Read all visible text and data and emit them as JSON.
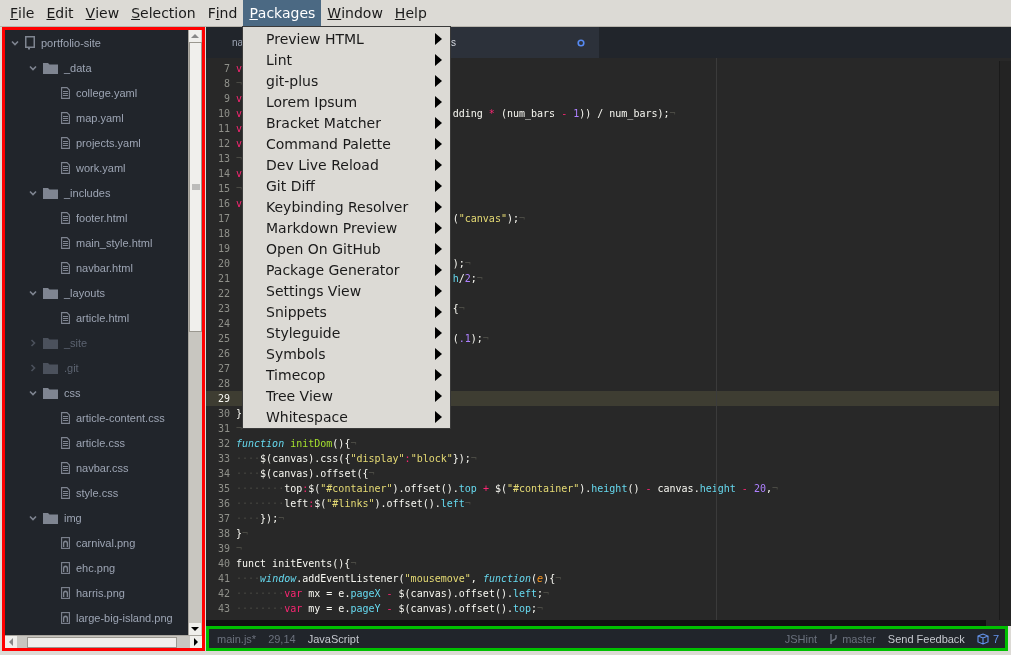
{
  "menubar": [
    {
      "mnemonic": "F",
      "rest": "ile",
      "selected": false
    },
    {
      "mnemonic": "E",
      "rest": "dit",
      "selected": false
    },
    {
      "mnemonic": "V",
      "rest": "iew",
      "selected": false
    },
    {
      "mnemonic": "S",
      "rest": "election",
      "selected": false
    },
    {
      "before": "F",
      "mnemonic": "i",
      "rest": "nd",
      "selected": false
    },
    {
      "mnemonic": "P",
      "rest": "ackages",
      "selected": true
    },
    {
      "mnemonic": "W",
      "rest": "indow",
      "selected": false
    },
    {
      "mnemonic": "H",
      "rest": "elp",
      "selected": false
    }
  ],
  "packages_menu": [
    {
      "label": "Preview HTML"
    },
    {
      "label": "Lint"
    },
    {
      "label": "git-plus"
    },
    {
      "label": "Lorem Ipsum"
    },
    {
      "label": "Bracket Matcher"
    },
    {
      "label": "Command Palette"
    },
    {
      "label": "Dev Live Reload"
    },
    {
      "label": "Git Diff"
    },
    {
      "label": "Keybinding Resolver"
    },
    {
      "label": "Markdown Preview"
    },
    {
      "label": "Open On GitHub"
    },
    {
      "label": "Package Generator"
    },
    {
      "label": "Settings View"
    },
    {
      "label": "Snippets"
    },
    {
      "label": "Styleguide"
    },
    {
      "label": "Symbols"
    },
    {
      "label": "Timecop"
    },
    {
      "label": "Tree View"
    },
    {
      "label": "Whitespace"
    }
  ],
  "tree": [
    {
      "label": "portfolio-site",
      "kind": "repo",
      "expanded": true,
      "dimmed": false,
      "children": [
        {
          "label": "_data",
          "kind": "folder",
          "expanded": true,
          "dimmed": false,
          "children": [
            {
              "label": "college.yaml",
              "kind": "file",
              "dimmed": false
            },
            {
              "label": "map.yaml",
              "kind": "file",
              "dimmed": false
            },
            {
              "label": "projects.yaml",
              "kind": "file",
              "dimmed": false
            },
            {
              "label": "work.yaml",
              "kind": "file",
              "dimmed": false
            }
          ]
        },
        {
          "label": "_includes",
          "kind": "folder",
          "expanded": true,
          "dimmed": false,
          "children": [
            {
              "label": "footer.html",
              "kind": "file",
              "dimmed": false
            },
            {
              "label": "main_style.html",
              "kind": "file",
              "dimmed": false
            },
            {
              "label": "navbar.html",
              "kind": "file",
              "dimmed": false
            }
          ]
        },
        {
          "label": "_layouts",
          "kind": "folder",
          "expanded": true,
          "dimmed": false,
          "children": [
            {
              "label": "article.html",
              "kind": "file",
              "dimmed": false
            }
          ]
        },
        {
          "label": "_site",
          "kind": "folder",
          "expanded": false,
          "dimmed": true
        },
        {
          "label": ".git",
          "kind": "folder",
          "expanded": false,
          "dimmed": true
        },
        {
          "label": "css",
          "kind": "folder",
          "expanded": true,
          "dimmed": false,
          "children": [
            {
              "label": "article-content.css",
              "kind": "file",
              "dimmed": false
            },
            {
              "label": "article.css",
              "kind": "file",
              "dimmed": false
            },
            {
              "label": "navbar.css",
              "kind": "file",
              "dimmed": false
            },
            {
              "label": "style.css",
              "kind": "file",
              "dimmed": false
            }
          ]
        },
        {
          "label": "img",
          "kind": "folder",
          "expanded": true,
          "dimmed": false,
          "children": [
            {
              "label": "carnival.png",
              "kind": "image",
              "dimmed": false
            },
            {
              "label": "ehc.png",
              "kind": "image",
              "dimmed": false
            },
            {
              "label": "harris.png",
              "kind": "image",
              "dimmed": false
            },
            {
              "label": "large-big-island.png",
              "kind": "image",
              "dimmed": false
            }
          ]
        }
      ]
    }
  ],
  "tabs": [
    {
      "label": "na",
      "selected": false
    },
    {
      "label": "s",
      "selected": true,
      "modified": true
    }
  ],
  "code_lines": [
    {
      "number": "7",
      "current": false,
      "left": [
        {
          "text": "v",
          "kind": "keyword"
        }
      ]
    },
    {
      "number": "8",
      "current": false,
      "left": [
        {
          "text": "¬",
          "kind": "invisible"
        }
      ]
    },
    {
      "number": "9",
      "current": false,
      "left": [
        {
          "text": "v",
          "kind": "keyword"
        }
      ]
    },
    {
      "number": "10",
      "current": false,
      "left": [
        {
          "text": "v",
          "kind": "keyword"
        }
      ],
      "right": [
        {
          "text": "dding ",
          "kind": "plain"
        },
        {
          "text": "*",
          "kind": "keyword"
        },
        {
          "text": " (num_bars ",
          "kind": "plain"
        },
        {
          "text": "-",
          "kind": "keyword"
        },
        {
          "text": " 1",
          "kind": "number"
        },
        {
          "text": ")) / num_bars);",
          "kind": "plain"
        },
        {
          "text": "¬",
          "kind": "invisible"
        }
      ]
    },
    {
      "number": "11",
      "current": false,
      "left": [
        {
          "text": "v",
          "kind": "keyword"
        }
      ]
    },
    {
      "number": "12",
      "current": false,
      "left": [
        {
          "text": "v",
          "kind": "keyword"
        }
      ]
    },
    {
      "number": "13",
      "current": false,
      "left": [
        {
          "text": "¬",
          "kind": "invisible"
        }
      ]
    },
    {
      "number": "14",
      "current": false,
      "left": [
        {
          "text": "v",
          "kind": "keyword"
        }
      ]
    },
    {
      "number": "15",
      "current": false,
      "left": [
        {
          "text": "¬",
          "kind": "invisible"
        }
      ]
    },
    {
      "number": "16",
      "current": false,
      "left": [
        {
          "text": "v",
          "kind": "keyword"
        }
      ]
    },
    {
      "number": "17",
      "current": false,
      "right": [
        {
          "text": "(",
          "kind": "plain"
        },
        {
          "text": "\"canvas\"",
          "kind": "string"
        },
        {
          "text": ");",
          "kind": "plain"
        },
        {
          "text": "¬",
          "kind": "invisible"
        }
      ]
    },
    {
      "number": "18",
      "current": false
    },
    {
      "number": "19",
      "current": false
    },
    {
      "number": "20",
      "current": false,
      "right": [
        {
          "text": ");",
          "kind": "plain"
        },
        {
          "text": "¬",
          "kind": "invisible"
        }
      ]
    },
    {
      "number": "21",
      "current": false,
      "right": [
        {
          "text": "h",
          "kind": "property"
        },
        {
          "text": "/",
          "kind": "plain"
        },
        {
          "text": "2",
          "kind": "number"
        },
        {
          "text": ";",
          "kind": "plain"
        },
        {
          "text": "¬",
          "kind": "invisible"
        }
      ]
    },
    {
      "number": "22",
      "current": false
    },
    {
      "number": "23",
      "current": false,
      "right": [
        {
          "text": "{",
          "kind": "plain"
        },
        {
          "text": "¬",
          "kind": "invisible"
        }
      ]
    },
    {
      "number": "24",
      "current": false
    },
    {
      "number": "25",
      "current": false,
      "right": [
        {
          "text": "(",
          "kind": "plain"
        },
        {
          "text": ".1",
          "kind": "number"
        },
        {
          "text": ");",
          "kind": "plain"
        },
        {
          "text": "¬",
          "kind": "invisible"
        }
      ]
    },
    {
      "number": "26",
      "current": false
    },
    {
      "number": "27",
      "current": false
    },
    {
      "number": "28",
      "current": false
    },
    {
      "number": "29",
      "current": true
    },
    {
      "number": "30",
      "current": false,
      "left": [
        {
          "text": "}",
          "kind": "plain"
        }
      ]
    },
    {
      "number": "31",
      "current": false,
      "left": [
        {
          "text": "¬",
          "kind": "invisible"
        }
      ]
    },
    {
      "number": "32",
      "current": false,
      "left": [
        {
          "text": "function ",
          "kind": "storage"
        },
        {
          "text": "initDom",
          "kind": "name"
        },
        {
          "text": "(){",
          "kind": "plain"
        },
        {
          "text": "¬",
          "kind": "invisible"
        }
      ]
    },
    {
      "number": "33",
      "current": false,
      "left": [
        {
          "text": "····",
          "kind": "invisible"
        },
        {
          "text": "$(canvas).css({",
          "kind": "plain"
        },
        {
          "text": "\"display\"",
          "kind": "string"
        },
        {
          "text": ":",
          "kind": "keyword"
        },
        {
          "text": "\"block\"",
          "kind": "string"
        },
        {
          "text": "});",
          "kind": "plain"
        },
        {
          "text": "¬",
          "kind": "invisible"
        }
      ]
    },
    {
      "number": "34",
      "current": false,
      "left": [
        {
          "text": "····",
          "kind": "invisible"
        },
        {
          "text": "$(canvas).offset({",
          "kind": "plain"
        },
        {
          "text": "¬",
          "kind": "invisible"
        }
      ]
    },
    {
      "number": "35",
      "current": false,
      "left": [
        {
          "text": "········",
          "kind": "invisible"
        },
        {
          "text": "top",
          "kind": "plain"
        },
        {
          "text": ":",
          "kind": "keyword"
        },
        {
          "text": "$(",
          "kind": "plain"
        },
        {
          "text": "\"#container\"",
          "kind": "string"
        },
        {
          "text": ").offset().",
          "kind": "plain"
        },
        {
          "text": "top ",
          "kind": "property"
        },
        {
          "text": "+",
          "kind": "keyword"
        },
        {
          "text": " $(",
          "kind": "plain"
        },
        {
          "text": "\"#container\"",
          "kind": "string"
        },
        {
          "text": ").",
          "kind": "plain"
        },
        {
          "text": "height",
          "kind": "property"
        },
        {
          "text": "() ",
          "kind": "plain"
        },
        {
          "text": "-",
          "kind": "keyword"
        },
        {
          "text": " canvas.",
          "kind": "plain"
        },
        {
          "text": "height ",
          "kind": "property"
        },
        {
          "text": "-",
          "kind": "keyword"
        },
        {
          "text": " 20",
          "kind": "number"
        },
        {
          "text": ",",
          "kind": "plain"
        },
        {
          "text": "¬",
          "kind": "invisible"
        }
      ]
    },
    {
      "number": "36",
      "current": false,
      "left": [
        {
          "text": "········",
          "kind": "invisible"
        },
        {
          "text": "left",
          "kind": "plain"
        },
        {
          "text": ":",
          "kind": "keyword"
        },
        {
          "text": "$(",
          "kind": "plain"
        },
        {
          "text": "\"#links\"",
          "kind": "string"
        },
        {
          "text": ").offset().",
          "kind": "plain"
        },
        {
          "text": "left",
          "kind": "property"
        },
        {
          "text": "¬",
          "kind": "invisible"
        }
      ]
    },
    {
      "number": "37",
      "current": false,
      "left": [
        {
          "text": "····",
          "kind": "invisible"
        },
        {
          "text": "});",
          "kind": "plain"
        },
        {
          "text": "¬",
          "kind": "invisible"
        }
      ]
    },
    {
      "number": "38",
      "current": false,
      "left": [
        {
          "text": "}",
          "kind": "plain"
        },
        {
          "text": "¬",
          "kind": "invisible"
        }
      ]
    },
    {
      "number": "39",
      "current": false,
      "left": [
        {
          "text": "¬",
          "kind": "invisible"
        }
      ]
    },
    {
      "number": "40",
      "current": false,
      "left": [
        {
          "text": "funct initEvents(){",
          "kind": "plain"
        },
        {
          "text": "¬",
          "kind": "invisible"
        }
      ]
    },
    {
      "number": "41",
      "current": false,
      "left": [
        {
          "text": "····",
          "kind": "invisible"
        },
        {
          "text": "window",
          "kind": "storage"
        },
        {
          "text": ".addEventListener(",
          "kind": "plain"
        },
        {
          "text": "\"mousemove\"",
          "kind": "string"
        },
        {
          "text": ", ",
          "kind": "plain"
        },
        {
          "text": "function",
          "kind": "storage"
        },
        {
          "text": "(",
          "kind": "plain"
        },
        {
          "text": "e",
          "kind": "param"
        },
        {
          "text": "){",
          "kind": "plain"
        },
        {
          "text": "¬",
          "kind": "invisible"
        }
      ]
    },
    {
      "number": "42",
      "current": false,
      "left": [
        {
          "text": "········",
          "kind": "invisible"
        },
        {
          "text": "var",
          "kind": "keyword"
        },
        {
          "text": " mx = e.",
          "kind": "plain"
        },
        {
          "text": "pageX ",
          "kind": "property"
        },
        {
          "text": "-",
          "kind": "keyword"
        },
        {
          "text": " $(canvas).offset().",
          "kind": "plain"
        },
        {
          "text": "left",
          "kind": "property"
        },
        {
          "text": ";",
          "kind": "plain"
        },
        {
          "text": "¬",
          "kind": "invisible"
        }
      ]
    },
    {
      "number": "43",
      "current": false,
      "left": [
        {
          "text": "········",
          "kind": "invisible"
        },
        {
          "text": "var",
          "kind": "keyword"
        },
        {
          "text": " my = e.",
          "kind": "plain"
        },
        {
          "text": "pageY ",
          "kind": "property"
        },
        {
          "text": "-",
          "kind": "keyword"
        },
        {
          "text": " $(canvas).offset().",
          "kind": "plain"
        },
        {
          "text": "top",
          "kind": "property"
        },
        {
          "text": ";",
          "kind": "plain"
        },
        {
          "text": "¬",
          "kind": "invisible"
        }
      ]
    }
  ],
  "status_bar": {
    "file": "main.js*",
    "cursor": "29,14",
    "grammar": "JavaScript",
    "linter": "JSHint",
    "branch": "master",
    "feedback": "Send Feedback",
    "updates": "7"
  }
}
